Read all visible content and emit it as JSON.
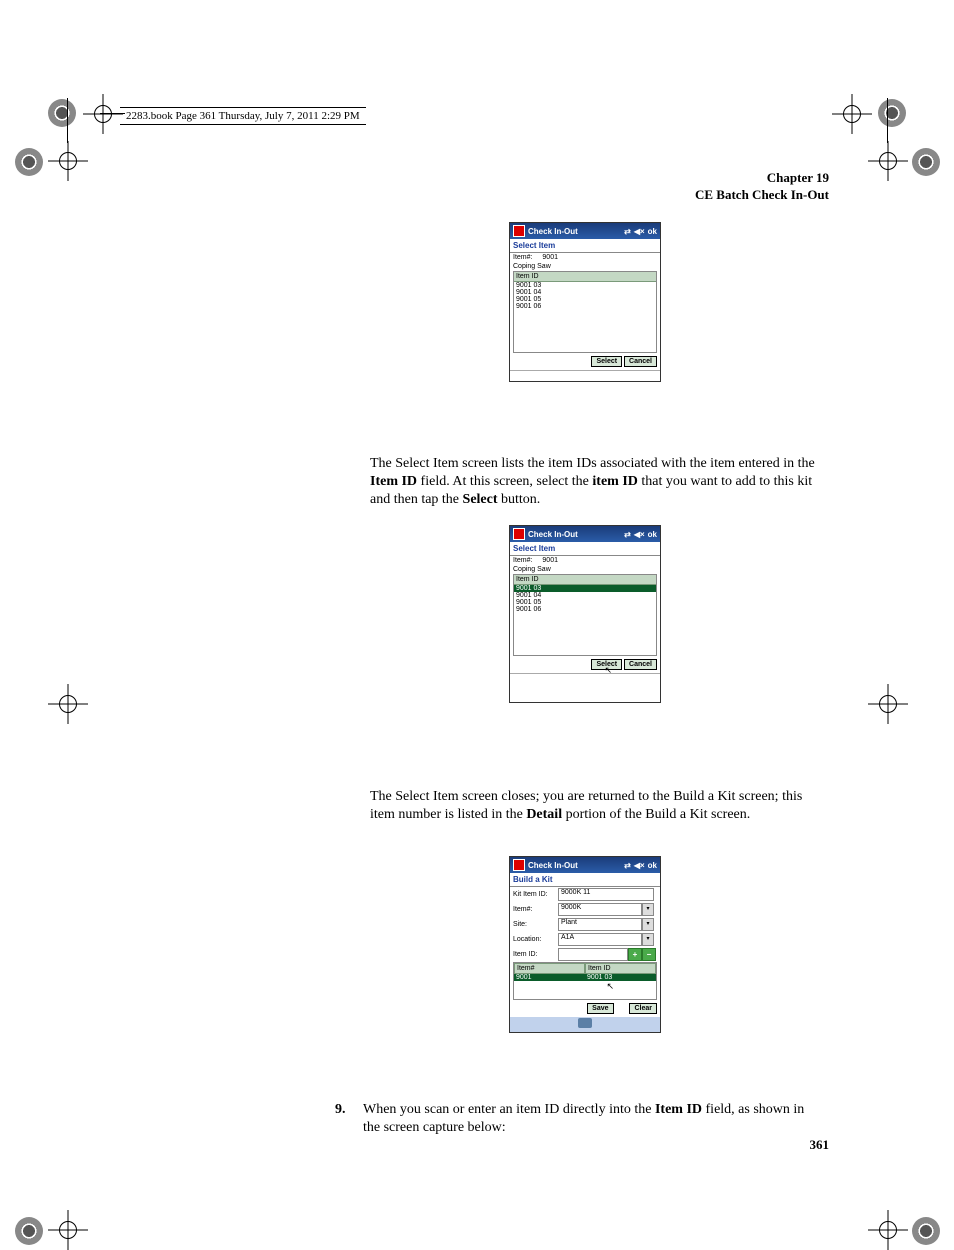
{
  "book_header": "2283.book  Page 361  Thursday, July 7, 2011  2:29 PM",
  "chapter": {
    "line1": "Chapter 19",
    "line2": "CE Batch Check In-Out"
  },
  "page_number": "361",
  "pda_common": {
    "title": "Check In-Out",
    "ok": "ok"
  },
  "pda1": {
    "subtitle": "Select Item",
    "item_no_label": "Item#:",
    "item_no_value": "9001",
    "item_desc": "Coping Saw",
    "header": "Item ID",
    "items": [
      "9001 03",
      "9001 04",
      "9001 05",
      "9001 06"
    ],
    "btn_select": "Select",
    "btn_cancel": "Cancel"
  },
  "para1": {
    "t1": "The Select Item screen lists the item IDs associated with the item entered in the ",
    "b1": "Item ID",
    "t2": " field. At this screen, select the ",
    "b2": "item ID",
    "t3": " that you want to add to this kit and then tap the ",
    "b3": "Select",
    "t4": " button."
  },
  "pda2": {
    "subtitle": "Select Item",
    "item_no_label": "Item#:",
    "item_no_value": "9001",
    "item_desc": "Coping Saw",
    "header": "Item ID",
    "items": [
      "9001 03",
      "9001 04",
      "9001 05",
      "9001 06"
    ],
    "selected_index": 0,
    "btn_select": "Select",
    "btn_cancel": "Cancel"
  },
  "para2": {
    "t1": "The Select Item screen closes; you are returned to the Build a Kit screen; this item number is listed in the ",
    "b1": "Detail",
    "t2": " portion of the Build a Kit screen."
  },
  "pda3": {
    "subtitle": "Build a Kit",
    "fields": {
      "kit_item_id_label": "Kit Item ID:",
      "kit_item_id_value": "9000K 11",
      "item_no_label": "Item#:",
      "item_no_value": "9000K",
      "site_label": "Site:",
      "site_value": "Plant",
      "location_label": "Location:",
      "location_value": "A1A",
      "item_id_label": "Item ID:",
      "item_id_value": ""
    },
    "table": {
      "hdr1": "Item#",
      "hdr2": "Item ID",
      "row1c1": "9001",
      "row1c2": "9001 03"
    },
    "btn_save": "Save",
    "btn_clear": "Clear"
  },
  "step9": {
    "num": "9.",
    "t1": "When you scan or enter an item ID directly into the ",
    "b1": "Item ID",
    "t2": " field, as shown in the screen capture below:"
  }
}
